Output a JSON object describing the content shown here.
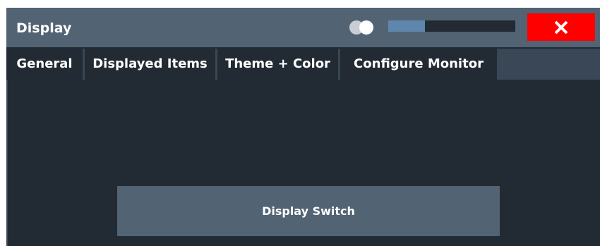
{
  "window": {
    "title": "Display",
    "transparency_level": 0.29
  },
  "tabs": [
    {
      "label": "General"
    },
    {
      "label": "Displayed Items"
    },
    {
      "label": "Theme + Color"
    },
    {
      "label": "Configure Monitor",
      "active": true
    }
  ],
  "content": {
    "display_switch_label": "Display Switch"
  },
  "colors": {
    "title_bar": "#526373",
    "panel": "#222a33",
    "close": "#ff0000",
    "accent": "#5f87ad"
  }
}
